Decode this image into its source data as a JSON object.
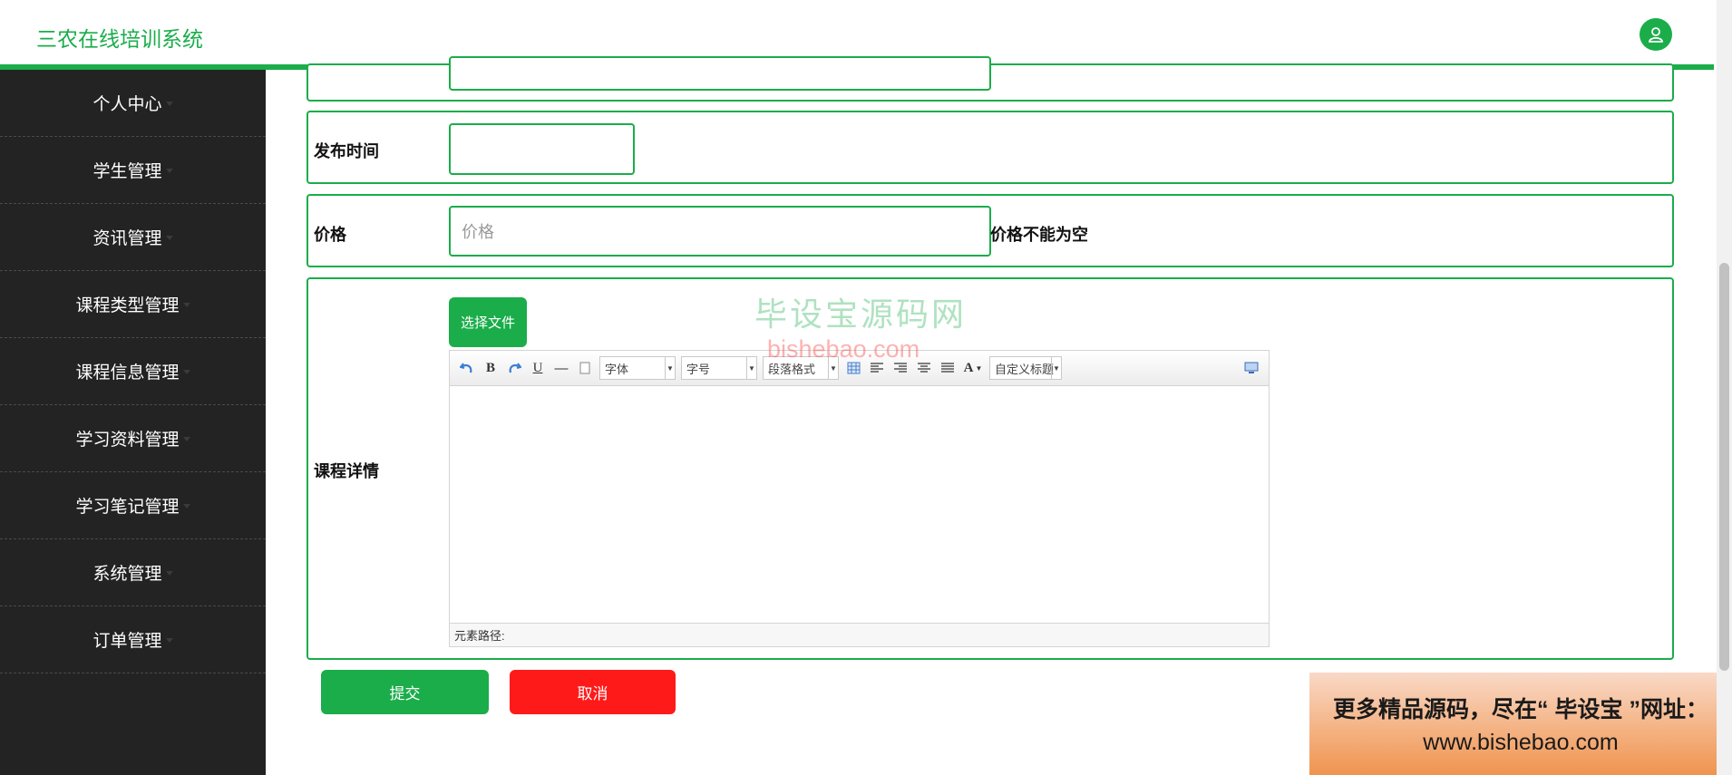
{
  "header": {
    "title": "三农在线培训系统"
  },
  "sidebar": {
    "items": [
      {
        "label": "个人中心"
      },
      {
        "label": "学生管理"
      },
      {
        "label": "资讯管理"
      },
      {
        "label": "课程类型管理"
      },
      {
        "label": "课程信息管理"
      },
      {
        "label": "学习资料管理"
      },
      {
        "label": "学习笔记管理"
      },
      {
        "label": "系统管理"
      },
      {
        "label": "订单管理"
      }
    ]
  },
  "form": {
    "publish_time": {
      "label": "发布时间",
      "value": ""
    },
    "price": {
      "label": "价格",
      "placeholder": "价格",
      "error": "价格不能为空"
    },
    "details": {
      "label": "课程详情",
      "upload_label": "选择文件",
      "editor": {
        "font_select": "字体",
        "size_select": "字号",
        "paragraph_select": "段落格式",
        "custom_title_select": "自定义标题",
        "status_path": "元素路径:"
      }
    },
    "submit_label": "提交",
    "cancel_label": "取消"
  },
  "colors": {
    "accent": "#1aad4a",
    "danger": "#ff1a1a",
    "sidebar_bg": "#232323"
  },
  "watermark": {
    "name": "毕设宝源码网",
    "url": "bishebao.com"
  },
  "promo": {
    "line1": "更多精品源码，尽在“ 毕设宝 ”网址：",
    "line2": "www.bishebao.com"
  }
}
